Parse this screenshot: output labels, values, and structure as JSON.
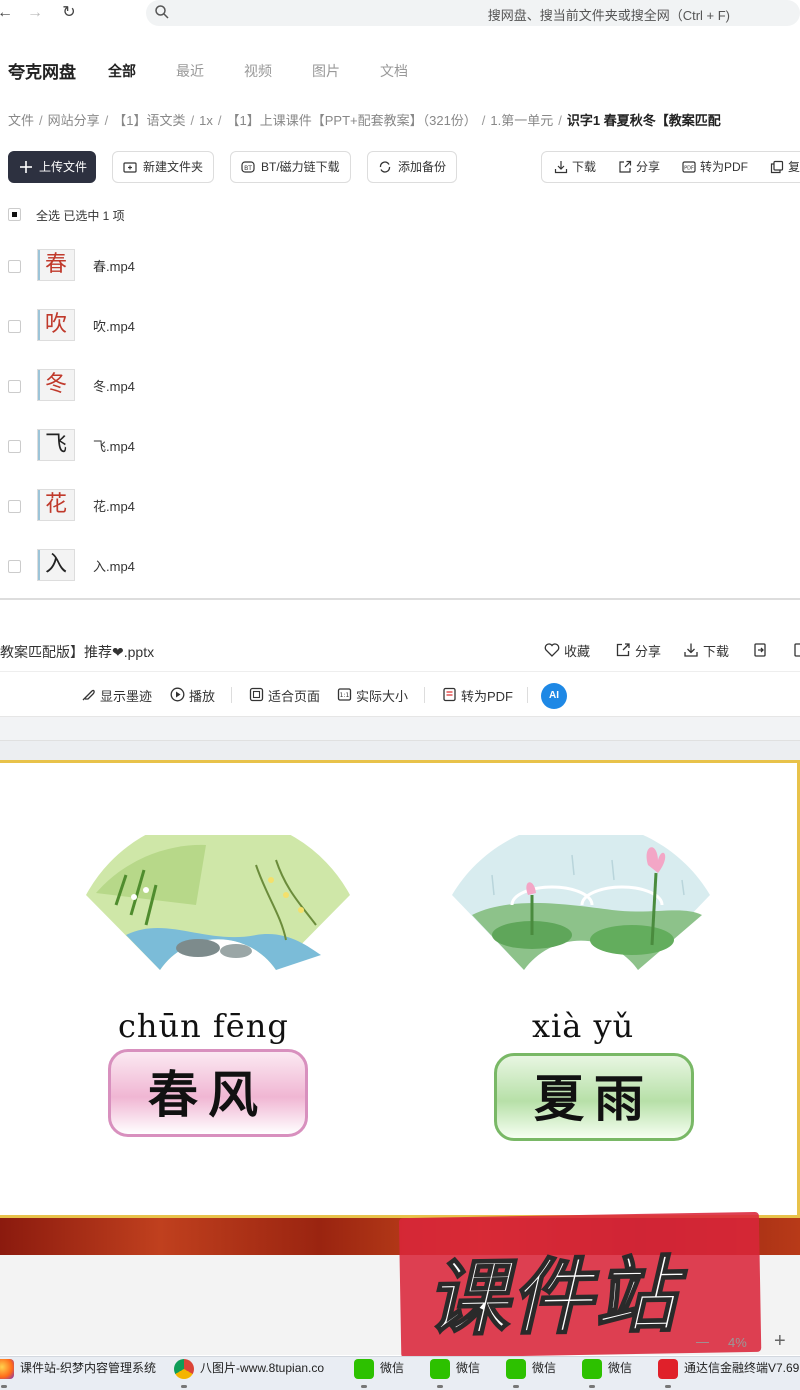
{
  "browser": {
    "search_placeholder": "搜网盘、搜当前文件夹或搜全网（Ctrl + F)"
  },
  "app": {
    "logo": "夸克网盘",
    "tabs": [
      "全部",
      "最近",
      "视频",
      "图片",
      "文档"
    ]
  },
  "breadcrumb": [
    "文件",
    "网站分享",
    "【1】语文类",
    "1x",
    "【1】上课课件【PPT+配套教案】（321份）",
    "1.第一单元",
    "识字1 春夏秋冬【教案匹配"
  ],
  "actions": {
    "upload": "上传文件",
    "new_folder": "新建文件夹",
    "bt_download": "BT/磁力链下载",
    "backup": "添加备份",
    "download": "下载",
    "share": "分享",
    "to_pdf": "转为PDF",
    "copy": "复"
  },
  "selection": {
    "label": "全选  已选中  1  项"
  },
  "files": [
    {
      "thumb_char": "春",
      "name": "春.mp4"
    },
    {
      "thumb_char": "吹",
      "name": "吹.mp4"
    },
    {
      "thumb_char": "冬",
      "name": "冬.mp4"
    },
    {
      "thumb_char": "飞",
      "name": "飞.mp4"
    },
    {
      "thumb_char": "花",
      "name": "花.mp4"
    },
    {
      "thumb_char": "入",
      "name": "入.mp4"
    }
  ],
  "preview": {
    "title": "教案匹配版】推荐❤.pptx",
    "collect": "收藏",
    "share": "分享",
    "download": "下载",
    "toolbar": {
      "show_ink": "显示墨迹",
      "play": "播放",
      "fit_page": "适合页面",
      "actual_size": "实际大小",
      "to_pdf": "转为PDF",
      "ai": "AI"
    }
  },
  "slide": {
    "left": {
      "pinyin": "chūn fēng",
      "word": "春风"
    },
    "right": {
      "pinyin": "xià yǔ",
      "word": "夏雨"
    }
  },
  "watermark": "课件站",
  "zoom": "4%",
  "taskbar": [
    {
      "label": "课件站-织梦内容管理系统",
      "icon": "firefox-icon"
    },
    {
      "label": "八图片-www.8tupian.co",
      "icon": "chrome-icon"
    },
    {
      "label": "微信",
      "icon": "wechat-icon"
    },
    {
      "label": "微信",
      "icon": "wechat-icon"
    },
    {
      "label": "微信",
      "icon": "wechat-icon"
    },
    {
      "label": "微信",
      "icon": "wechat-icon"
    },
    {
      "label": "通达信金融终端V7.69",
      "icon": "tdx-icon"
    }
  ],
  "colors": {
    "primary_button": "#2d3140",
    "slide_border": "#e8c24a",
    "watermark_red": "#d9253a",
    "ai_blue": "#1e88e5"
  }
}
